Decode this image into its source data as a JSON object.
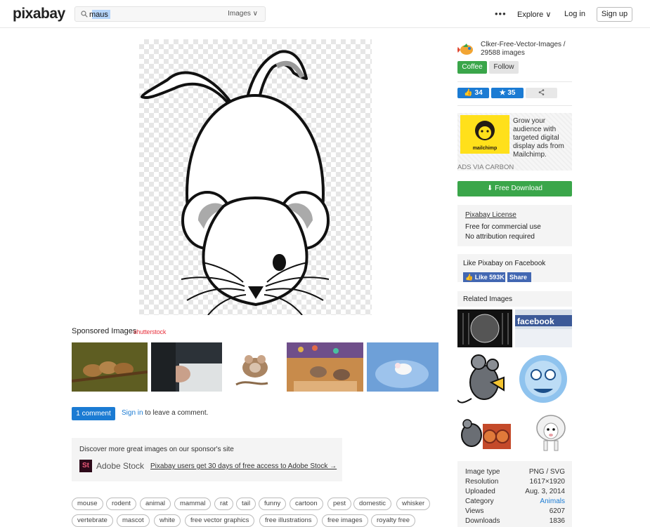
{
  "header": {
    "logo": "pixabay",
    "search_value": "maus",
    "search_type": "Images ∨",
    "more_label": "•••",
    "explore_label": "Explore ∨",
    "login_label": "Log in",
    "signup_label": "Sign up"
  },
  "main_image": {
    "icon": "mouse-cartoon-illustration"
  },
  "sponsored": {
    "title": "Sponsored Images",
    "brand": "shutterstock"
  },
  "comments": {
    "count_label": "1 comment",
    "signin_label": "Sign in",
    "rest_text": " to leave a comment."
  },
  "adobe": {
    "title": "Discover more great images on our sponsor's site",
    "logo_text": "St",
    "name": "Adobe Stock",
    "offer": "Pixabay users get 30 days of free access to Adobe Stock →"
  },
  "tags": [
    "mouse",
    "rodent",
    "animal",
    "mammal",
    "rat",
    "tail",
    "funny",
    "cartoon",
    "pest",
    "domestic",
    "whisker",
    "vertebrate",
    "mascot",
    "white",
    "free vector graphics",
    "free illustrations",
    "free images",
    "royalty free"
  ],
  "uploader": {
    "name": "Clker-Free-Vector-Images /",
    "count": "29588 images",
    "coffee_label": "Coffee",
    "follow_label": "Follow"
  },
  "stats": {
    "likes": "34",
    "favorites": "35",
    "share_icon": "share-icon"
  },
  "ad": {
    "brand": "mailchimp",
    "text": "Grow your audience with targeted digital display ads from Mailchimp.",
    "via": "ADS VIA CARBON"
  },
  "download": {
    "label": "⬇ Free Download"
  },
  "license": {
    "title": "Pixabay License",
    "line1": "Free for commercial use",
    "line2": "No attribution required"
  },
  "facebook": {
    "title": "Like Pixabay on Facebook",
    "like_label": "👍 Like 593K",
    "share_label": "Share"
  },
  "related": {
    "title": "Related Images"
  },
  "info": {
    "rows": [
      {
        "key": "Image type",
        "value": "PNG / SVG"
      },
      {
        "key": "Resolution",
        "value": "1617×1920"
      },
      {
        "key": "Uploaded",
        "value": "Aug. 3, 2014"
      },
      {
        "key": "Category",
        "value": "Animals"
      },
      {
        "key": "Views",
        "value": "6207"
      },
      {
        "key": "Downloads",
        "value": "1836"
      }
    ]
  },
  "colors": {
    "green": "#3aa64a",
    "blue": "#1b7bd3",
    "facebook": "#4267b2",
    "mailchimp_yellow": "#ffe01b"
  }
}
